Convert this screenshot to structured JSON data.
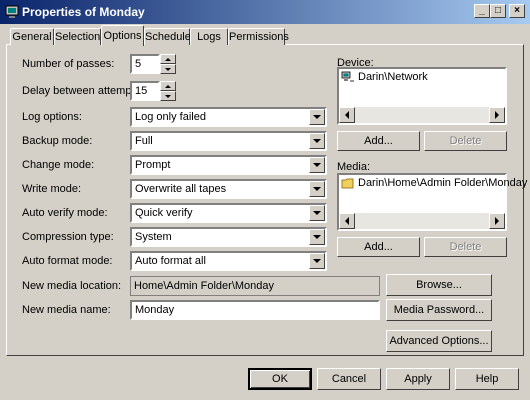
{
  "window": {
    "title": "Properties of Monday",
    "min": "_",
    "max": "□",
    "close": "×"
  },
  "tabs": [
    "General",
    "Selection",
    "Options",
    "Schedule",
    "Logs",
    "Permissions"
  ],
  "active_tab": "Options",
  "fields": {
    "passes_label": "Number of passes:",
    "passes_value": "5",
    "delay_label": "Delay between attempts:",
    "delay_value": "15",
    "log_label": "Log options:",
    "log_value": "Log only failed",
    "backup_label": "Backup mode:",
    "backup_value": "Full",
    "change_label": "Change mode:",
    "change_value": "Prompt",
    "write_label": "Write mode:",
    "write_value": "Overwrite all tapes",
    "verify_label": "Auto verify mode:",
    "verify_value": "Quick verify",
    "compression_label": "Compression type:",
    "compression_value": "System",
    "format_label": "Auto format mode:",
    "format_value": "Auto format all",
    "location_label": "New media location:",
    "location_value": "Home\\Admin Folder\\Monday",
    "name_label": "New media name:",
    "name_value": "Monday"
  },
  "device": {
    "label": "Device:",
    "items": [
      "Darin\\Network"
    ],
    "add": "Add...",
    "delete": "Delete"
  },
  "media": {
    "label": "Media:",
    "items": [
      "Darin\\Home\\Admin Folder\\Monday"
    ],
    "add": "Add...",
    "delete": "Delete"
  },
  "buttons": {
    "browse": "Browse...",
    "media_password": "Media Password...",
    "advanced": "Advanced Options...",
    "ok": "OK",
    "cancel": "Cancel",
    "apply": "Apply",
    "help": "Help"
  }
}
